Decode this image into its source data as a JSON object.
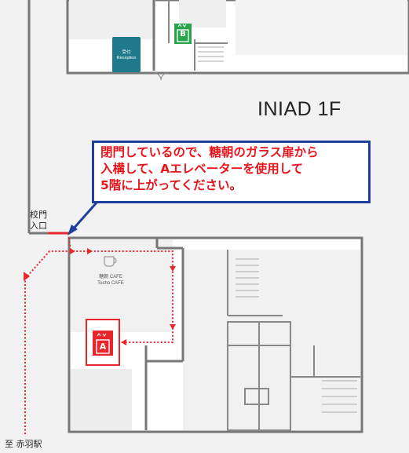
{
  "floor_label": "INIAD 1F",
  "notice": {
    "lines": [
      "閉門しているので、糖朝のガラス扉から",
      "入構して、Aエレベーターを使用して",
      "5階に上がってください。"
    ],
    "text_color": "#e8141c",
    "border_color": "#1f3f9e"
  },
  "gate_label": [
    "校門",
    "入口"
  ],
  "station_label": "至 赤羽駅",
  "cafe": {
    "name": "糖朝 CAFE",
    "sub": "Tosho CAFE"
  },
  "reception": {
    "name": "受付",
    "sub": "Reception"
  },
  "elevator_a": {
    "letter": "A",
    "color": "#e8262b",
    "icon": "elevator-icon"
  },
  "elevator_b": {
    "letter": "B",
    "color": "#2aa34a",
    "icon": "elevator-icon"
  },
  "route_color": "#e8262b"
}
